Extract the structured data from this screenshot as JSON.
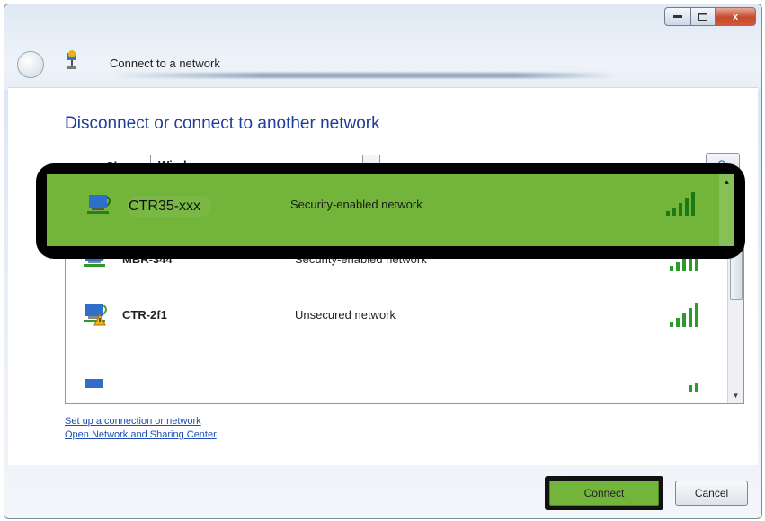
{
  "window": {
    "title": "Connect to a network",
    "controls": {
      "minimize": "",
      "maximize": "",
      "close": "x"
    }
  },
  "heading": "Disconnect or connect to another network",
  "show": {
    "label": "Show",
    "value": "Wireless"
  },
  "networks": [
    {
      "name": "CTR35-xxx",
      "security": "Security-enabled network",
      "selected": true,
      "icon": "wireless-network-icon"
    },
    {
      "name": "MBR-344",
      "security": "Security-enabled network",
      "selected": false,
      "icon": "wireless-network-icon"
    },
    {
      "name": "CTR-2f1",
      "security": "Unsecured network",
      "selected": false,
      "icon": "unsecured-wireless-network-icon"
    }
  ],
  "links": {
    "setup": "Set up a connection or network",
    "sharing": "Open Network and Sharing Center"
  },
  "buttons": {
    "connect": "Connect",
    "cancel": "Cancel"
  },
  "colors": {
    "highlight": "#72b53a",
    "heading": "#1f3d9c",
    "link": "#1f4fb5"
  }
}
